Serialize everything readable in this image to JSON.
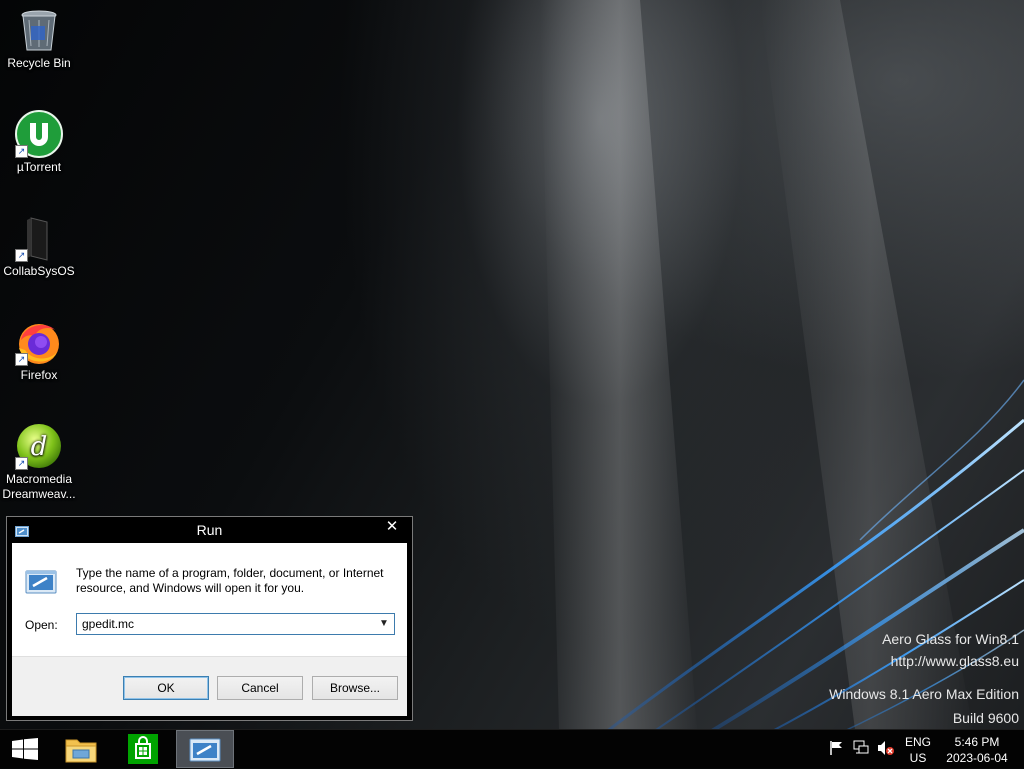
{
  "desktop": {
    "icons": [
      {
        "label": "Recycle Bin",
        "icon": "recycle-bin-icon"
      },
      {
        "label": "µTorrent",
        "icon": "utorrent-icon"
      },
      {
        "label": "CollabSysOS",
        "icon": "collabsysos-icon"
      },
      {
        "label": "Firefox",
        "icon": "firefox-icon"
      },
      {
        "label_line1": "Macromedia",
        "label_line2": "Dreamweav...",
        "icon": "dreamweaver-icon"
      }
    ]
  },
  "run_dialog": {
    "title": "Run",
    "close_glyph": "✕",
    "description": "Type the name of a program, folder, document, or Internet resource, and Windows will open it for you.",
    "open_label": "Open:",
    "open_value": "gpedit.mc",
    "buttons": {
      "ok": "OK",
      "cancel": "Cancel",
      "browse": "Browse..."
    }
  },
  "watermark": {
    "line1": "Aero Glass for Win8.1",
    "line2": "http://www.glass8.eu",
    "line3": "Windows 8.1 Aero Max Edition",
    "line4": "Build 9600"
  },
  "taskbar": {
    "start_icon": "windows-logo-icon",
    "pinned": [
      "file-explorer-icon",
      "store-icon",
      "run-icon"
    ],
    "tray": {
      "icons": [
        "flag-icon",
        "network-icon",
        "volume-muted-icon"
      ],
      "language_line1": "ENG",
      "language_line2": "US",
      "time": "5:46 PM",
      "date": "2023-06-04"
    }
  },
  "colors": {
    "taskbar": "#030303",
    "active_taskbar_button": "#4a4e54",
    "focus_border": "#3d7bad",
    "accent_blue": "#3aa0ff"
  }
}
